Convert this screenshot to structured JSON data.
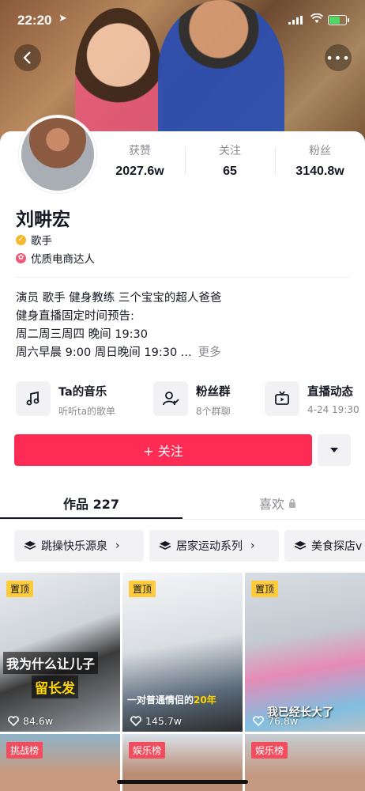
{
  "status_bar": {
    "time": "22:20"
  },
  "profile": {
    "name": "刘畊宏",
    "verified_label": "歌手",
    "seller_label": "优质电商达人",
    "stats": [
      {
        "label": "获赞",
        "value": "2027.6w"
      },
      {
        "label": "关注",
        "value": "65"
      },
      {
        "label": "粉丝",
        "value": "3140.8w"
      }
    ],
    "bio_lines": [
      "演员 歌手 健身教练 三个宝宝的超人爸爸",
      "健身直播固定时间预告:",
      "周二周三周四 晚间 19:30",
      "周六早晨 9:00 周日晚间 19:30 ..."
    ],
    "bio_more": "更多"
  },
  "quick_links": [
    {
      "title": "Ta的音乐",
      "sub": "听听ta的歌单",
      "icon": "music-note-icon"
    },
    {
      "title": "粉丝群",
      "sub": "8个群聊",
      "icon": "fan-group-icon"
    },
    {
      "title": "直播动态",
      "sub": "4-24 19:30",
      "icon": "tv-icon"
    }
  ],
  "actions": {
    "follow_label": "+ 关注"
  },
  "tabs": {
    "works": "作品 227",
    "likes": "喜欢"
  },
  "collections": [
    {
      "label": "跳操快乐源泉"
    },
    {
      "label": "居家运动系列"
    },
    {
      "label": "美食探店v"
    }
  ],
  "videos": [
    {
      "tag": "置顶",
      "tag_type": "pin",
      "likes": "84.6w",
      "caption_a": "我为什么让儿子",
      "caption_b": "留长发"
    },
    {
      "tag": "置顶",
      "tag_type": "pin",
      "likes": "145.7w",
      "caption_a": "一对普通情侣的",
      "caption_b": "20年"
    },
    {
      "tag": "置顶",
      "tag_type": "pin",
      "likes": "76.8w",
      "caption_a": "我已经长大了"
    },
    {
      "tag": "挑战榜",
      "tag_type": "rank"
    },
    {
      "tag": "娱乐榜",
      "tag_type": "rank"
    },
    {
      "tag": "娱乐榜",
      "tag_type": "rank"
    }
  ],
  "colors": {
    "accent": "#fe2c55",
    "pin": "#fdcb3b",
    "rank": "#f04d5e"
  }
}
